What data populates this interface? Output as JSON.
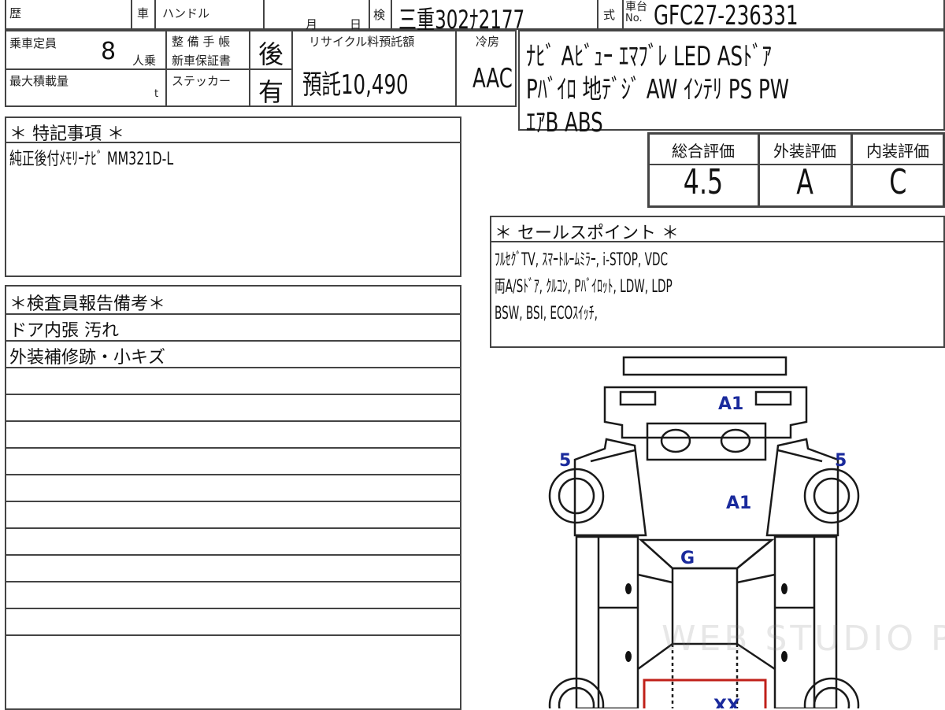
{
  "header": {
    "history_label": "歴",
    "car_label": "車",
    "handle_label": "ハンドル",
    "month_label": "月",
    "day_label": "日",
    "inspection_label": "検",
    "plate": "三重302ﾅ2177",
    "model_label": "式",
    "chassis_label_top": "車台",
    "chassis_label_bottom": "No.",
    "chassis_no": "GFC27-236331"
  },
  "specs": {
    "capacity_label": "乗車定員",
    "capacity_value": "8",
    "capacity_unit": "人乗",
    "load_label": "最大積載量",
    "load_unit": "t",
    "manual_label": "整 備 手 帳",
    "warranty_label": "新車保証書",
    "sticker_label": "ステッカー",
    "manual_value": "後",
    "sticker_value": "有",
    "recycle_label": "リサイクル料預託額",
    "recycle_value": "預託10,490",
    "ac_label": "冷房",
    "ac_value": "AAC"
  },
  "equipment": {
    "lines": [
      "ﾅﾋﾞ Aﾋﾞｭｰ ｴﾏﾌﾞﾚ LED ASﾄﾞｱ",
      "Pﾊﾞｲﾛ 地ﾃﾞｼﾞ AW ｲﾝﾃﾘ PS PW",
      "ｴｱB ABS"
    ]
  },
  "grades": {
    "overall_label": "総合評価",
    "exterior_label": "外装評価",
    "interior_label": "内装評価",
    "overall_value": "4.5",
    "exterior_value": "A",
    "interior_value": "C"
  },
  "special_notes": {
    "title": "＊ 特記事項 ＊",
    "lines": [
      "純正後付ﾒﾓﾘｰﾅﾋﾞ MM321D-L"
    ]
  },
  "inspector_notes": {
    "title": "＊検査員報告備考＊",
    "lines": [
      "ドア内張 汚れ",
      "外装補修跡・小キズ",
      "",
      "",
      "",
      "",
      "",
      "",
      "",
      "",
      "",
      "",
      ""
    ]
  },
  "sales_points": {
    "title": "＊ セールスポイント ＊",
    "lines": [
      "ﾌﾙｾｸﾞTV, ｽﾏｰﾄﾙｰﾑﾐﾗｰ, i-STOP, VDC",
      "両A/Sﾄﾞｱ, ｸﾙｺﾝ, Pﾊﾞｲﾛｯﾄ, LDW, LDP",
      "BSW, BSI, ECOｽｲｯﾁ,"
    ]
  },
  "diagram": {
    "marks": [
      {
        "code": "A1",
        "part": "front-bumper"
      },
      {
        "code": "5",
        "part": "left-front-wheel"
      },
      {
        "code": "5",
        "part": "right-front-wheel"
      },
      {
        "code": "A1",
        "part": "hood"
      },
      {
        "code": "G",
        "part": "windshield"
      },
      {
        "code": "XX",
        "part": "roof"
      }
    ]
  },
  "watermark": "WEB STUDIO PRO"
}
